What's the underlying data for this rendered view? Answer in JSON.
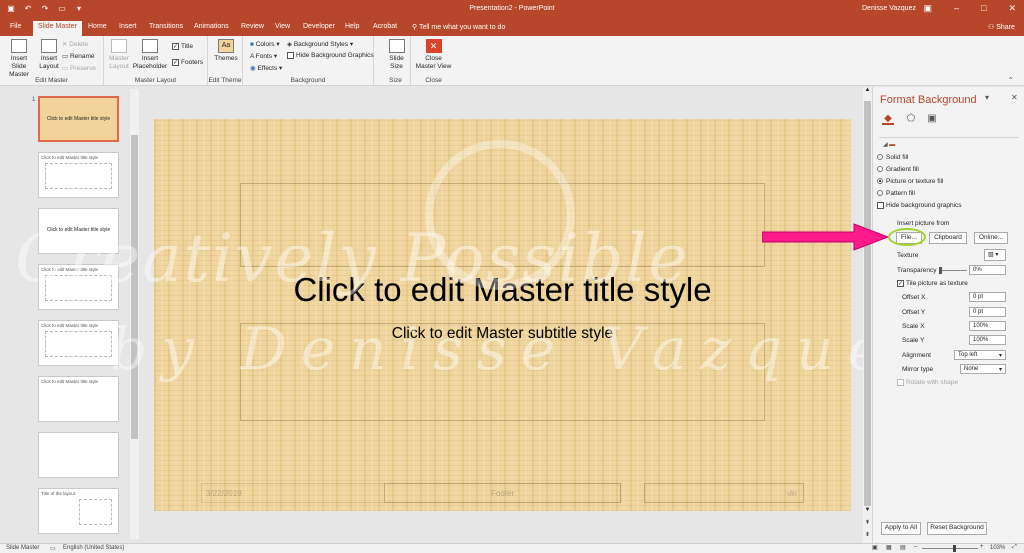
{
  "window": {
    "title": "Presentation2  -  PowerPoint",
    "user": "Denisse Vazquez"
  },
  "tabs": [
    "File",
    "Slide Master",
    "Home",
    "Insert",
    "Transitions",
    "Animations",
    "Review",
    "View",
    "Developer",
    "Help",
    "Acrobat"
  ],
  "tell_me": "Tell me what you want to do",
  "share": "Share",
  "ribbon": {
    "edit_master": {
      "label": "Edit Master",
      "insert_slide_master": "Insert Slide Master",
      "insert_layout": "Insert Layout",
      "delete": "Delete",
      "rename": "Rename",
      "preserve": "Preserve"
    },
    "master_layout": {
      "label": "Master Layout",
      "master_layout_btn": "Master Layout",
      "insert_placeholder": "Insert Placeholder",
      "title": "Title",
      "footers": "Footers"
    },
    "edit_theme": {
      "label": "Edit Theme",
      "themes": "Themes"
    },
    "background": {
      "label": "Background",
      "colors": "Colors",
      "fonts": "Fonts",
      "effects": "Effects",
      "background_styles": "Background Styles",
      "hide_bg_graphics": "Hide Background Graphics"
    },
    "size": {
      "label": "Size",
      "slide_size": "Slide Size"
    },
    "close": {
      "label": "Close",
      "close_master_view": "Close Master View"
    }
  },
  "thumbnails": [
    {
      "num": "1",
      "title": "Click to edit Master title style",
      "selected": true
    },
    {
      "num": "",
      "title": "Click to edit Master title style"
    },
    {
      "num": "",
      "title": "Click to edit Master title style"
    },
    {
      "num": "",
      "title": "Click to edit Master title style"
    },
    {
      "num": "",
      "title": "Click to edit Master title style"
    },
    {
      "num": "",
      "title": "Click to edit Master title style"
    },
    {
      "num": "",
      "title": ""
    },
    {
      "num": "",
      "title": "Title of the layout"
    }
  ],
  "slide": {
    "title": "Click to edit Master title style",
    "subtitle": "Click to edit Master subtitle style",
    "date": "3/22/2019",
    "footer": "Footer",
    "page": "‹#›"
  },
  "watermark": {
    "line1": "Creatively Possible",
    "line2": "by Denisse Vazquez"
  },
  "pane": {
    "title": "Format Background",
    "fill_options": [
      "Solid fill",
      "Gradient fill",
      "Picture or texture fill",
      "Pattern fill"
    ],
    "selected_fill": "Picture or texture fill",
    "hide_bg_graphics": "Hide background graphics",
    "insert_picture_from": "Insert picture from",
    "file_btn": "File...",
    "clipboard_btn": "Clipboard",
    "online_btn": "Online...",
    "texture": "Texture",
    "transparency": "Transparency",
    "transparency_value": "0%",
    "tile": "Tile picture as texture",
    "offset_x": "Offset X",
    "offset_x_value": "0 pt",
    "offset_y": "Offset Y",
    "offset_y_value": "0 pt",
    "scale_x": "Scale X",
    "scale_x_value": "100%",
    "scale_y": "Scale Y",
    "scale_y_value": "100%",
    "alignment": "Alignment",
    "alignment_value": "Top left",
    "mirror": "Mirror type",
    "mirror_value": "None",
    "rotate": "Rotate with shape",
    "apply_all": "Apply to All",
    "reset": "Reset Background"
  },
  "status": {
    "mode": "Slide Master",
    "language": "English (United States)",
    "zoom": "103%"
  },
  "colors": {
    "accent": "#b7472a",
    "highlight_arrow": "#ff1a8c",
    "highlight_circle": "#a4d233"
  }
}
